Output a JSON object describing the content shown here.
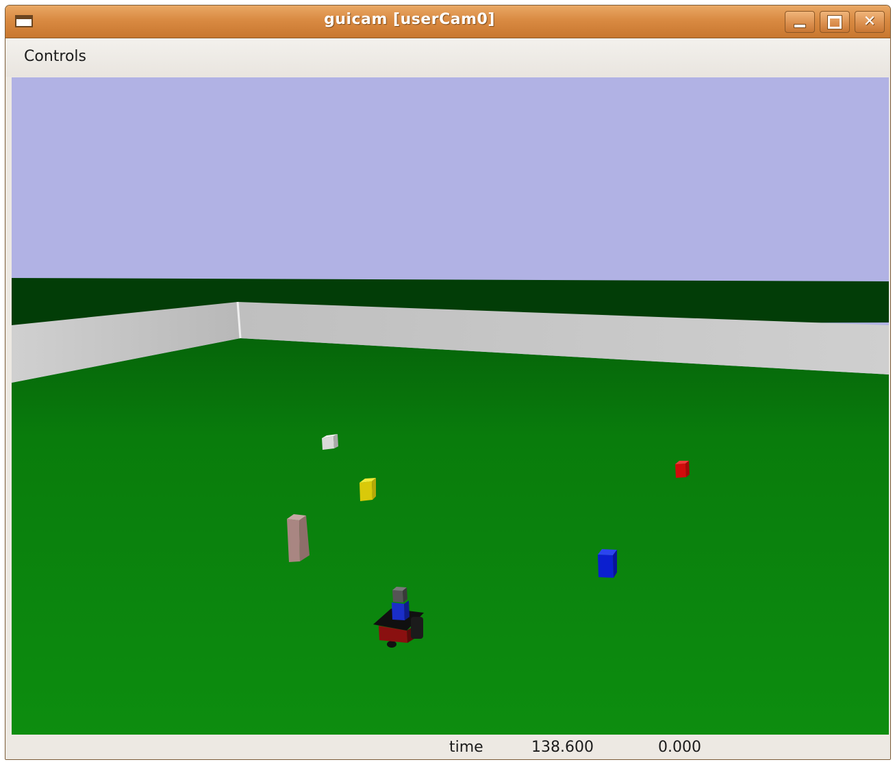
{
  "window": {
    "title": "guicam [userCam0]",
    "buttons": {
      "minimize_icon": "minimize-icon",
      "maximize_icon": "maximize-icon",
      "close_icon": "close-icon"
    }
  },
  "menu": {
    "items": [
      {
        "label": "Controls"
      }
    ]
  },
  "scene": {
    "sky_color": "#b1b2e4",
    "ground_color": "#0b8a0b",
    "wall_color": "#c8c8c8",
    "objects": [
      {
        "name": "white-box",
        "color": "#dcdcdc"
      },
      {
        "name": "yellow-box",
        "color": "#e5d70a"
      },
      {
        "name": "pink-box",
        "color": "#b08a86"
      },
      {
        "name": "red-box",
        "color": "#d80b0b"
      },
      {
        "name": "blue-box",
        "color": "#0b1fd0"
      },
      {
        "name": "robot",
        "color": "#8a1010"
      }
    ]
  },
  "status": {
    "label": "time",
    "sim_time": "138.600",
    "extra_value": "0.000"
  }
}
